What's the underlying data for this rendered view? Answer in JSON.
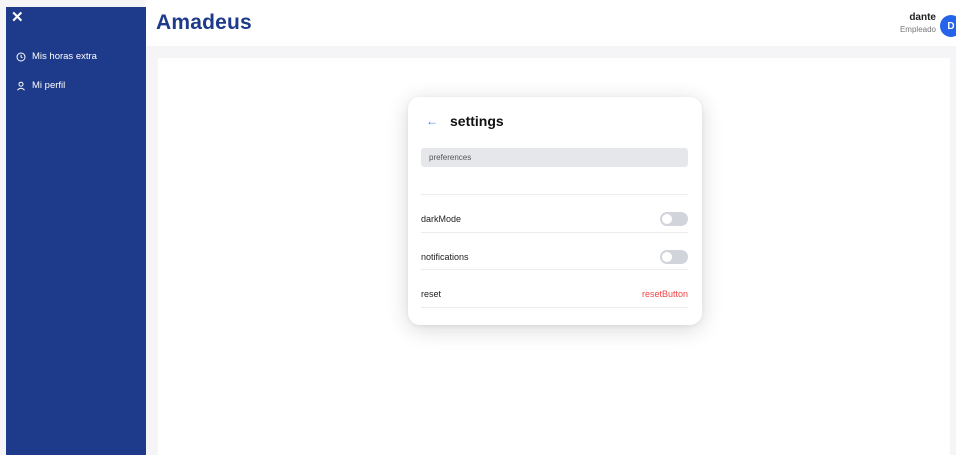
{
  "sidebar": {
    "close_glyph": "✕",
    "items": [
      {
        "label": "Mis horas extra",
        "icon": "clock-icon"
      },
      {
        "label": "Mi perfil",
        "icon": "user-icon"
      }
    ]
  },
  "header": {
    "brand": "Amadeus",
    "user": {
      "name": "dante",
      "role": "Empleado",
      "avatar_initial": "D"
    }
  },
  "settings": {
    "back_glyph": "←",
    "title": "settings",
    "section_label": "preferences",
    "rows": [
      {
        "label": "darkMode",
        "control": "toggle",
        "on": false
      },
      {
        "label": "notifications",
        "control": "toggle",
        "on": false
      },
      {
        "label": "reset",
        "control": "button",
        "button_label": "resetButton"
      }
    ]
  },
  "colors": {
    "sidebar": "#1e3a8a",
    "brand": "#1e3a8a",
    "accent": "#3b82f6",
    "danger": "#ef4444"
  }
}
